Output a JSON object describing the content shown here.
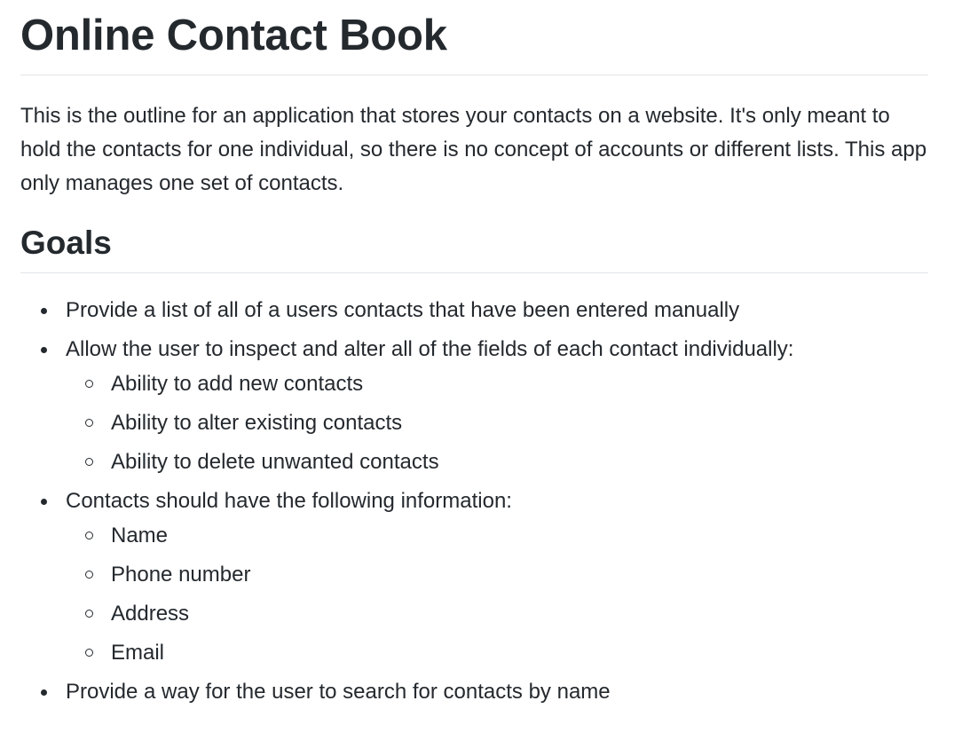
{
  "document": {
    "title": "Online Contact Book",
    "intro": "This is the outline for an application that stores your contacts on a website. It's only meant to hold the contacts for one individual, so there is no concept of accounts or different lists. This app only manages one set of contacts.",
    "goals_heading": "Goals",
    "goals": [
      {
        "text": "Provide a list of all of a users contacts that have been entered manually"
      },
      {
        "text": "Allow the user to inspect and alter all of the fields of each contact individually:",
        "children": [
          "Ability to add new contacts",
          "Ability to alter existing contacts",
          "Ability to delete unwanted contacts"
        ]
      },
      {
        "text": "Contacts should have the following information:",
        "children": [
          "Name",
          "Phone number",
          "Address",
          "Email"
        ]
      },
      {
        "text": "Provide a way for the user to search for contacts by name"
      }
    ]
  },
  "colors": {
    "text": "#24292e",
    "rule": "#e1e4e8",
    "background": "#ffffff"
  }
}
